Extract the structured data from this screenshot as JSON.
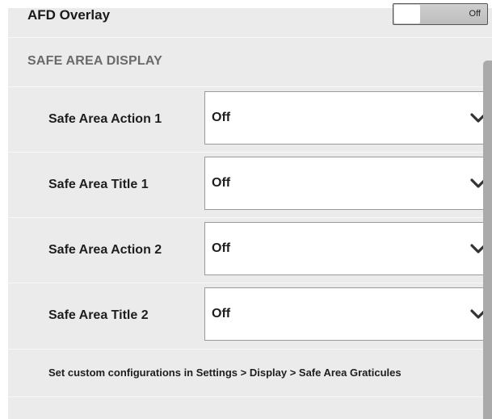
{
  "afd_overlay": {
    "label": "AFD Overlay",
    "toggle_state": "Off"
  },
  "safe_area_display": {
    "header": "SAFE AREA DISPLAY",
    "settings": [
      {
        "label": "Safe Area Action 1",
        "value": "Off"
      },
      {
        "label": "Safe Area Title 1",
        "value": "Off"
      },
      {
        "label": "Safe Area Action 2",
        "value": "Off"
      },
      {
        "label": "Safe Area Title 2",
        "value": "Off"
      }
    ],
    "footnote": "Set custom configurations in Settings > Display > Safe Area Graticules"
  },
  "icons": {
    "dropdown": "chevron-down-icon"
  }
}
